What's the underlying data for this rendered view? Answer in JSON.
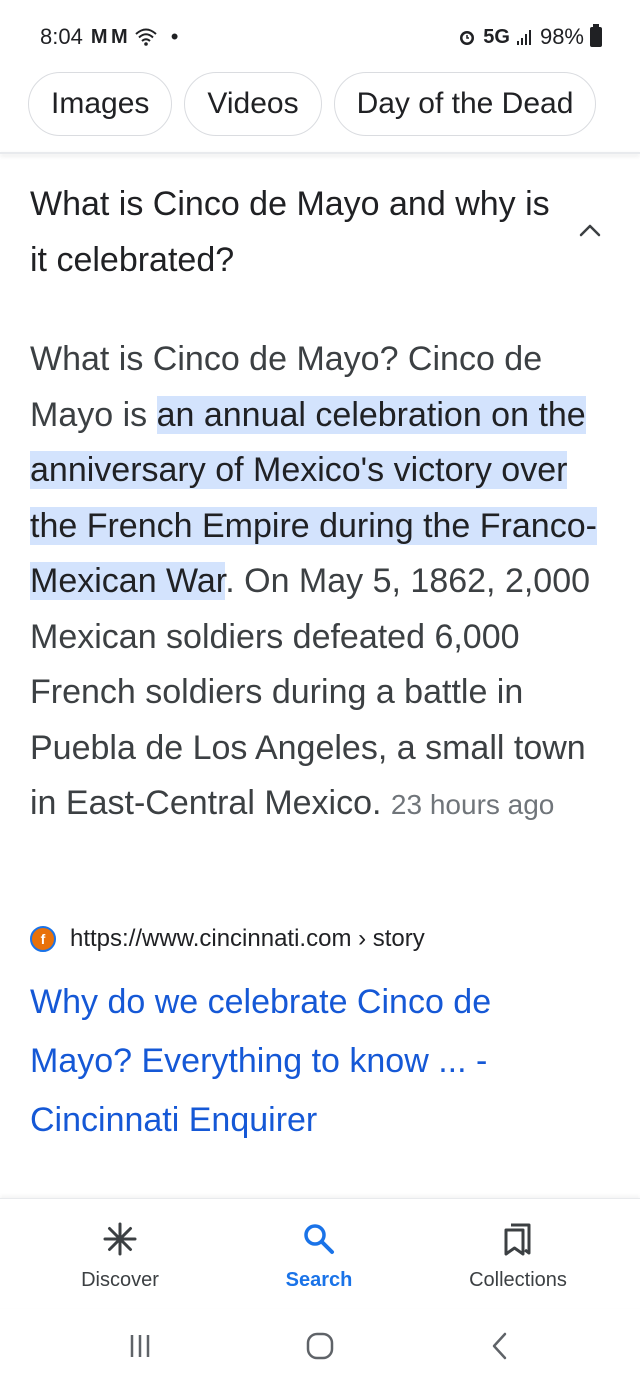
{
  "status": {
    "time": "8:04",
    "mail_icons": "M M",
    "dot": "•",
    "network": "5G",
    "battery": "98%"
  },
  "chips": [
    "Images",
    "Videos",
    "Day of the Dead"
  ],
  "question": "What is Cinco de Mayo and why is it celebrated?",
  "answer": {
    "intro": "What is Cinco de Mayo? Cinco de Mayo is ",
    "highlight": "an annual celebration on the anniversary of Mexico's victory over the French Empire during the Franco-Mexican War",
    "rest": ". On May 5, 1862, 2,000 Mexican soldiers defeated 6,000 French soldiers during a battle in Puebla de Los Angeles, a small town in East-Central Mexico.",
    "timestamp": "23 hours ago"
  },
  "source": {
    "url": "https://www.cincinnati.com › story",
    "title": "Why do we celebrate Cinco de Mayo? Everything to know ... - Cincinnati Enquirer"
  },
  "bottom_nav": {
    "discover": "Discover",
    "search": "Search",
    "collections": "Collections"
  },
  "colors": {
    "link": "#1558d6",
    "highlight": "#d3e3fd",
    "active_nav": "#1a73e8"
  }
}
